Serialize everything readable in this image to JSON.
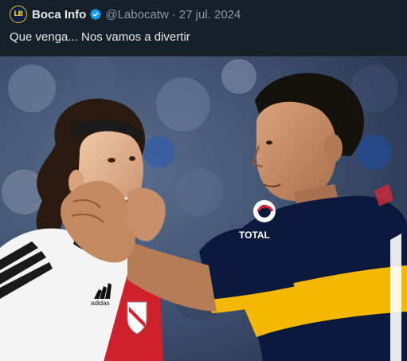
{
  "tweet": {
    "avatar_text": "LB",
    "display_name": "Boca Info",
    "handle": "@Labocatw",
    "separator": "·",
    "date": "27 jul. 2024",
    "text": "Que venga... Nos vamos a divertir"
  },
  "photo": {
    "shirt_right_brand": "TOTAL",
    "shirt_left_brand": "adidas"
  },
  "colors": {
    "background": "#15202b",
    "verified": "#1d9bf0",
    "text_primary": "#e7e9ea",
    "text_secondary": "#8b98a5",
    "boca_blue": "#0b1a3c",
    "boca_gold": "#f5b800",
    "river_red": "#d0202c"
  }
}
